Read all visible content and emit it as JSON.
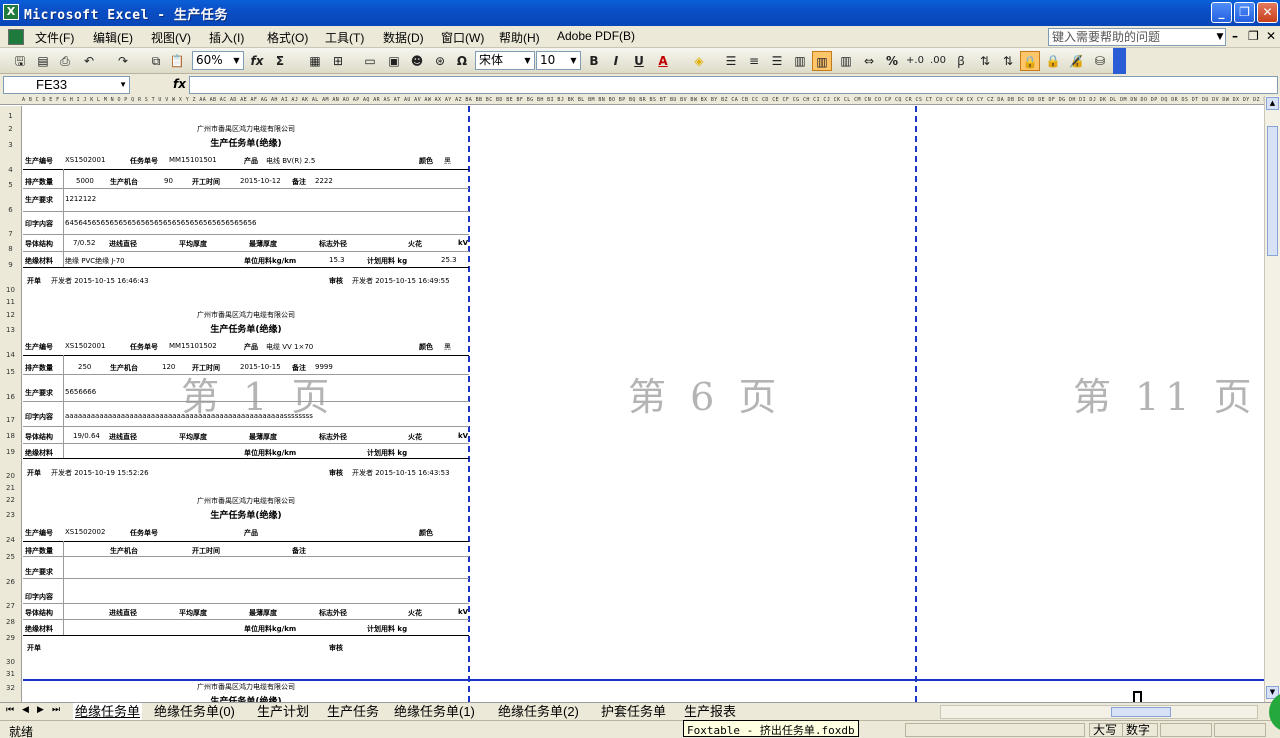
{
  "window": {
    "title": "Microsoft Excel - 生产任务",
    "app_icon": "excel-icon"
  },
  "menu": {
    "items": [
      "文件(F)",
      "编辑(E)",
      "视图(V)",
      "插入(I)",
      "格式(O)",
      "工具(T)",
      "数据(D)",
      "窗口(W)",
      "帮助(H)",
      "Adobe PDF(B)"
    ],
    "help_placeholder": "键入需要帮助的问题"
  },
  "toolbar": {
    "zoom": "60%",
    "font_name": "宋体",
    "font_size": "10",
    "bold": "B",
    "italic": "I",
    "underline": "U",
    "sum": "Σ",
    "fx": "fx",
    "omega": "Ω",
    "font_color": "A"
  },
  "formula_bar": {
    "name_box": "FE33",
    "fx_label": "fx",
    "formula": ""
  },
  "column_letters": "A B C D E F G H I J K L M N O P Q R S T U V W X Y Z AA AB AC AD AE AF AG AH AI AJ AK AL AM AN AO AP AQ AR AS AT AU AV AW AX AY AZ BA BB BC BD BE BF BG BH BI BJ BK BL BM BN BO BP BQ BR BS BT BU BV BW BX BY BZ CA CB CC CD CE CF CG CH CI CJ CK CL CM CN CO CP CQ CR CS CT CU CV CW CX CY CZ DA DB DC DD DE DF DG DH DI DJ DK DL DM DN DO DP DQ DR DS DT DU DV DW DX DY DZ EA EB EC ED EE EF EG EH EI EJ EK EL EM EN EO EP EQ ER ES ET EU EV EW EX EY EZ FA FB FC FD FE FF FG FH FI FJ FK FL FM FN FO FP FQ FR FS FT FU FV FW",
  "page_watermarks": [
    "第 1 页",
    "第 6 页",
    "第 11 页"
  ],
  "forms": [
    {
      "company": "广州市番禺区鸿力电缆有限公司",
      "title": "生产任务单(绝缘)",
      "lbl_prod_no": "生产编号",
      "prod_no": "XS1502001",
      "lbl_task_no": "任务单号",
      "task_no": "MM15101501",
      "lbl_product": "产品",
      "product": "电线 BV(R) 2.5",
      "lbl_color": "颜色",
      "color": "黑",
      "lbl_qty": "排产数量",
      "qty": "5000",
      "lbl_machine": "生产机台",
      "machine": "90",
      "lbl_start": "开工时间",
      "start": "2015-10-12",
      "lbl_note": "备注",
      "note": "2222",
      "lbl_req": "生产要求",
      "req": "1212122",
      "lbl_print": "印字内容",
      "print": "6456456565656565656565656565656565656565656",
      "lbl_conductor": "导体结构",
      "conductor": "7/0.52",
      "lbl_hole": "进线直径",
      "lbl_avg": "平均厚度",
      "lbl_min": "最薄厚度",
      "lbl_od": "标志外径",
      "lbl_spark": "火花",
      "lbl_kv": "kV",
      "lbl_insul": "绝缘材料",
      "insul": "绝缘 PVC绝缘 J-70",
      "lbl_unit_use": "单位用料kg/km",
      "unit_use": "15.3",
      "lbl_plan_use": "计划用料 kg",
      "plan_use": "25.3",
      "lbl_issuer": "开单",
      "issuer": "开发者 2015-10-15 16:46:43",
      "lbl_auditor": "审核",
      "auditor": "开发者 2015-10-15 16:49:55"
    },
    {
      "company": "广州市番禺区鸿力电缆有限公司",
      "title": "生产任务单(绝缘)",
      "lbl_prod_no": "生产编号",
      "prod_no": "XS1502001",
      "lbl_task_no": "任务单号",
      "task_no": "MM15101502",
      "lbl_product": "产品",
      "product": "电缆 VV 1×70",
      "lbl_color": "颜色",
      "color": "黑",
      "lbl_qty": "排产数量",
      "qty": "250",
      "lbl_machine": "生产机台",
      "machine": "120",
      "lbl_start": "开工时间",
      "start": "2015-10-15",
      "lbl_note": "备注",
      "note": "9999",
      "lbl_req": "生产要求",
      "req": "5656666",
      "lbl_print": "印字内容",
      "print": "aaaaaaaaaaaaaaaaaaaaaaaaaaaaaaaaaaaaaaaaaaaaaaaaaaassssssss",
      "lbl_conductor": "导体结构",
      "conductor": "19/0.64",
      "lbl_hole": "进线直径",
      "lbl_avg": "平均厚度",
      "lbl_min": "最薄厚度",
      "lbl_od": "标志外径",
      "lbl_spark": "火花",
      "lbl_kv": "kV",
      "lbl_insul": "绝缘材料",
      "insul": "",
      "lbl_unit_use": "单位用料kg/km",
      "unit_use": "",
      "lbl_plan_use": "计划用料 kg",
      "plan_use": "",
      "lbl_issuer": "开单",
      "issuer": "开发者 2015-10-19 15:52:26",
      "lbl_auditor": "审核",
      "auditor": "开发者 2015-10-15 16:43:53"
    },
    {
      "company": "广州市番禺区鸿力电缆有限公司",
      "title": "生产任务单(绝缘)",
      "lbl_prod_no": "生产编号",
      "prod_no": "XS1502002",
      "lbl_task_no": "任务单号",
      "task_no": "",
      "lbl_product": "产品",
      "product": "",
      "lbl_color": "颜色",
      "color": "",
      "lbl_qty": "排产数量",
      "qty": "",
      "lbl_machine": "生产机台",
      "machine": "",
      "lbl_start": "开工时间",
      "start": "",
      "lbl_note": "备注",
      "note": "",
      "lbl_req": "生产要求",
      "req": "",
      "lbl_print": "印字内容",
      "print": "",
      "lbl_conductor": "导体结构",
      "conductor": "",
      "lbl_hole": "进线直径",
      "lbl_avg": "平均厚度",
      "lbl_min": "最薄厚度",
      "lbl_od": "标志外径",
      "lbl_spark": "火花",
      "lbl_kv": "kV",
      "lbl_insul": "绝缘材料",
      "insul": "",
      "lbl_unit_use": "单位用料kg/km",
      "unit_use": "",
      "lbl_plan_use": "计划用料 kg",
      "plan_use": "",
      "lbl_issuer": "开单",
      "issuer": "",
      "lbl_auditor": "审核",
      "auditor": ""
    },
    {
      "company": "广州市番禺区鸿力电缆有限公司",
      "title": "生产任务单(绝缘)"
    }
  ],
  "sheet_tabs": [
    "绝缘任务单",
    "绝缘任务单(0)",
    "生产计划",
    "生产任务",
    "绝缘任务单(1)",
    "绝缘任务单(2)",
    "护套任务单",
    "生产报表"
  ],
  "status": {
    "text": "就绪",
    "caps": "大写",
    "num": "数字"
  },
  "tooltip": "Foxtable - 挤出任务单.foxdb",
  "colors": {
    "titlebar": "#0a5fd8",
    "page_break": "#1c34c6",
    "watermark": "#b4b4b4",
    "active_tool": "#ffc56b"
  }
}
